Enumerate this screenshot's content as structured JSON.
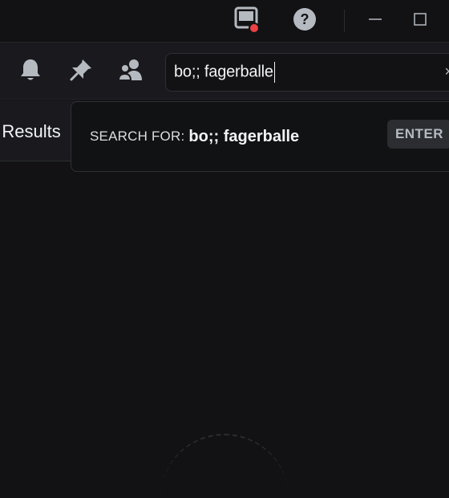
{
  "titlebar": {
    "inbox_icon": "inbox-icon",
    "help_icon": "help-icon",
    "minimize_icon": "minimize-icon",
    "maximize_icon": "maximize-icon",
    "alert_color": "#ed4245"
  },
  "header": {
    "icons": [
      "bell-icon",
      "pin-icon",
      "members-icon"
    ],
    "search": {
      "value": "bo;; fagerballe",
      "end_glyph": "×"
    }
  },
  "results": {
    "title": "o Results"
  },
  "popout": {
    "label": "SEARCH FOR:",
    "query": "bo;; fagerballe",
    "enter_badge": "ENTER"
  },
  "colors": {
    "background": "#121214",
    "header": "#1a1a1e",
    "text": "#dbdee1",
    "alert": "#ed4245"
  }
}
